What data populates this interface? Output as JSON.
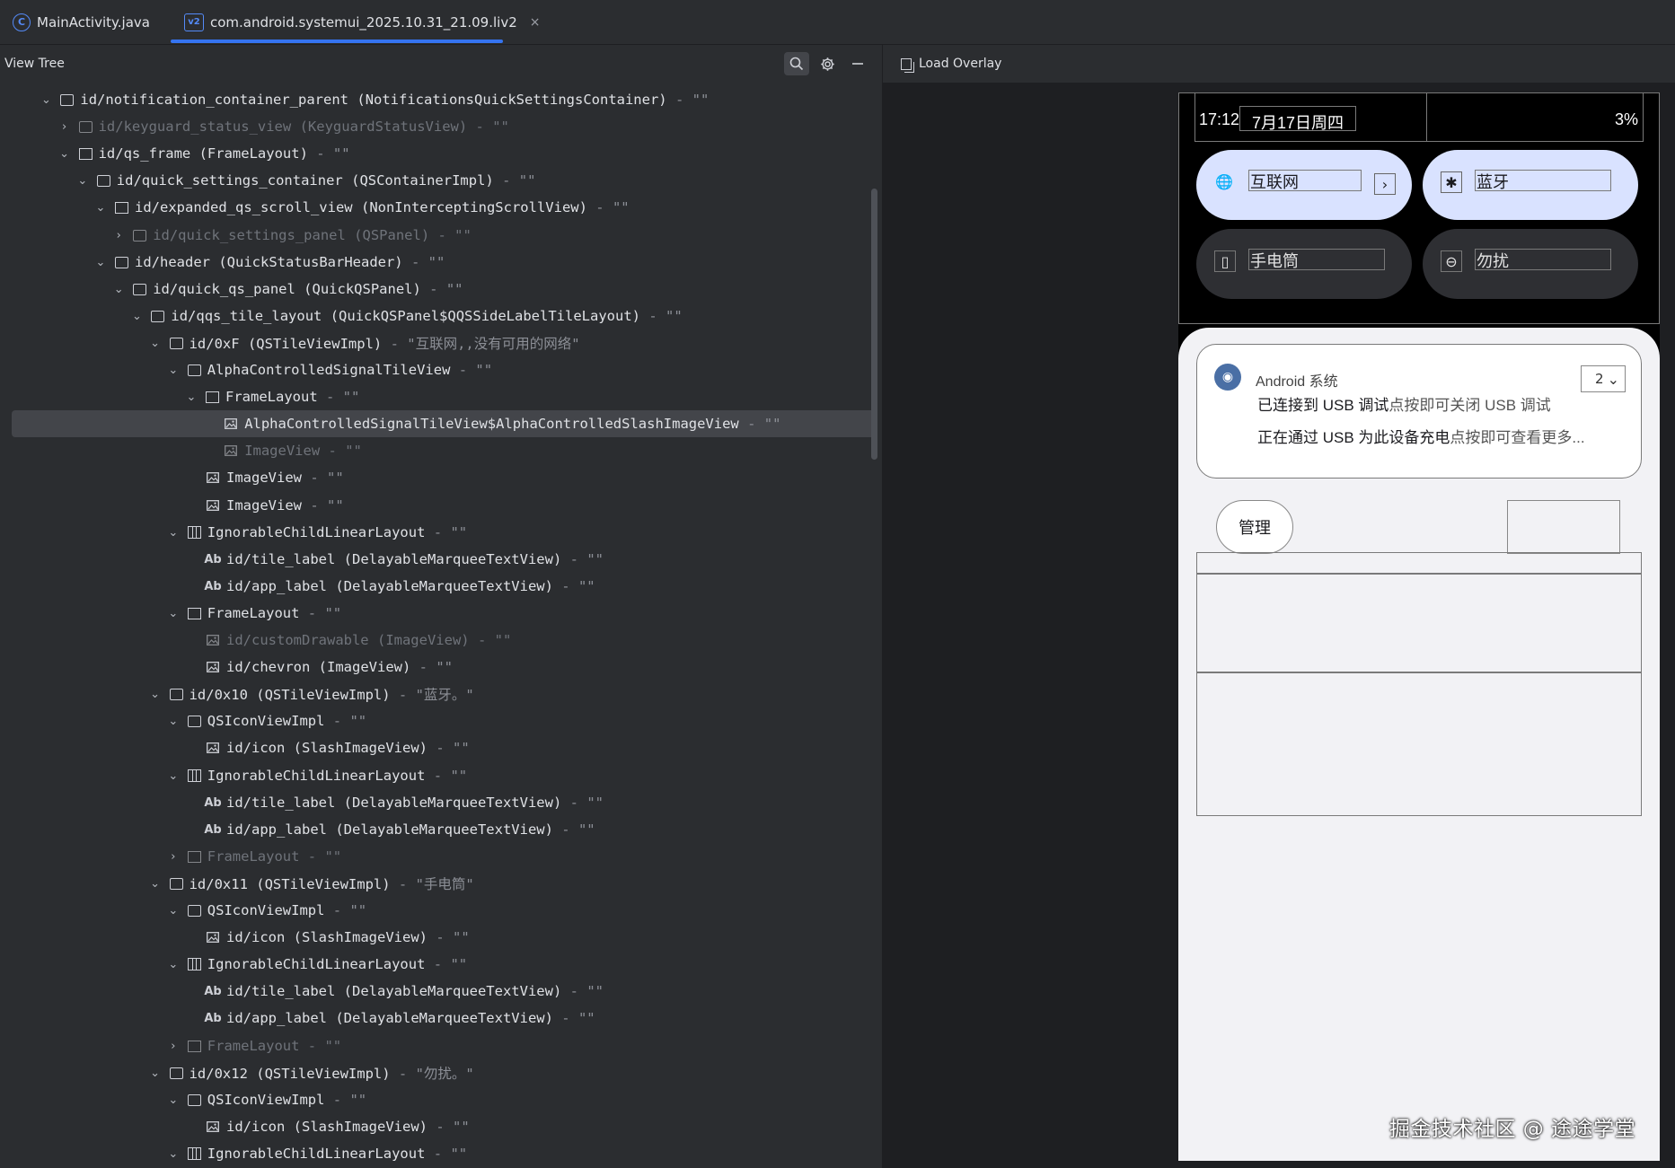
{
  "tabs": [
    {
      "icon": "class-icon",
      "icon_glyph": "C",
      "label": "MainActivity.java"
    },
    {
      "icon": "layout-file-icon",
      "icon_glyph": "v2",
      "label": "com.android.systemui_2025.10.31_21.09.liv2",
      "close_glyph": "×"
    }
  ],
  "left_panel": {
    "title": "View Tree",
    "tree": [
      {
        "chev": "⌄",
        "icon": "view",
        "id": "id/notification_container_parent",
        "cls": "(NotificationsQuickSettingsContainer)",
        "text": "\"\""
      },
      {
        "chev": "›",
        "icon": "view",
        "id": "id/keyguard_status_view",
        "cls": "(KeyguardStatusView)",
        "text": "\"\"",
        "disabled": true
      },
      {
        "chev": "⌄",
        "icon": "frame",
        "id": "id/qs_frame",
        "cls": "(FrameLayout)",
        "text": "\"\""
      },
      {
        "chev": "⌄",
        "icon": "view",
        "id": "id/quick_settings_container",
        "cls": "(QSContainerImpl)",
        "text": "\"\""
      },
      {
        "chev": "⌄",
        "icon": "frame",
        "id": "id/expanded_qs_scroll_view",
        "cls": "(NonInterceptingScrollView)",
        "text": "\"\""
      },
      {
        "chev": "›",
        "icon": "view",
        "id": "id/quick_settings_panel",
        "cls": "(QSPanel)",
        "text": "\"\"",
        "disabled": true
      },
      {
        "chev": "⌄",
        "icon": "view",
        "id": "id/header",
        "cls": "(QuickStatusBarHeader)",
        "text": "\"\""
      },
      {
        "chev": "⌄",
        "icon": "view",
        "id": "id/quick_qs_panel",
        "cls": "(QuickQSPanel)",
        "text": "\"\""
      },
      {
        "chev": "⌄",
        "icon": "view",
        "id": "id/qqs_tile_layout",
        "cls": "(QuickQSPanel$QQSSideLabelTileLayout)",
        "text": "\"\""
      },
      {
        "chev": "⌄",
        "icon": "view",
        "id": "id/0xF",
        "cls": "(QSTileViewImpl)",
        "text": "\"互联网,,没有可用的网络\""
      },
      {
        "chev": "⌄",
        "icon": "view",
        "id": "AlphaControlledSignalTileView",
        "cls": "",
        "text": "\"\""
      },
      {
        "chev": "⌄",
        "icon": "frame",
        "id": "FrameLayout",
        "cls": "",
        "text": "\"\""
      },
      {
        "chev": "",
        "icon": "image",
        "id": "AlphaControlledSignalTileView$AlphaControlledSlashImageView",
        "cls": "",
        "text": "\"\"",
        "selected": true
      },
      {
        "chev": "",
        "icon": "image",
        "id": "ImageView",
        "cls": "",
        "text": "\"\"",
        "disabled": true
      },
      {
        "chev": "",
        "icon": "image",
        "id": "ImageView",
        "cls": "",
        "text": "\"\""
      },
      {
        "chev": "",
        "icon": "image",
        "id": "ImageView",
        "cls": "",
        "text": "\"\""
      },
      {
        "chev": "⌄",
        "icon": "linear",
        "id": "IgnorableChildLinearLayout",
        "cls": "",
        "text": "\"\""
      },
      {
        "chev": "",
        "icon": "text",
        "id": "id/tile_label",
        "cls": "(DelayableMarqueeTextView)",
        "text": "\"\""
      },
      {
        "chev": "",
        "icon": "text",
        "id": "id/app_label",
        "cls": "(DelayableMarqueeTextView)",
        "text": "\"\""
      },
      {
        "chev": "⌄",
        "icon": "frame",
        "id": "FrameLayout",
        "cls": "",
        "text": "\"\""
      },
      {
        "chev": "",
        "icon": "image",
        "id": "id/customDrawable",
        "cls": "(ImageView)",
        "text": "\"\"",
        "disabled": true
      },
      {
        "chev": "",
        "icon": "image",
        "id": "id/chevron",
        "cls": "(ImageView)",
        "text": "\"\""
      },
      {
        "chev": "⌄",
        "icon": "view",
        "id": "id/0x10",
        "cls": "(QSTileViewImpl)",
        "text": "\"蓝牙。\""
      },
      {
        "chev": "⌄",
        "icon": "view",
        "id": "QSIconViewImpl",
        "cls": "",
        "text": "\"\""
      },
      {
        "chev": "",
        "icon": "image",
        "id": "id/icon",
        "cls": "(SlashImageView)",
        "text": "\"\""
      },
      {
        "chev": "⌄",
        "icon": "linear",
        "id": "IgnorableChildLinearLayout",
        "cls": "",
        "text": "\"\""
      },
      {
        "chev": "",
        "icon": "text",
        "id": "id/tile_label",
        "cls": "(DelayableMarqueeTextView)",
        "text": "\"\""
      },
      {
        "chev": "",
        "icon": "text",
        "id": "id/app_label",
        "cls": "(DelayableMarqueeTextView)",
        "text": "\"\""
      },
      {
        "chev": "›",
        "icon": "frame",
        "id": "FrameLayout",
        "cls": "",
        "text": "\"\"",
        "disabled": true
      },
      {
        "chev": "⌄",
        "icon": "view",
        "id": "id/0x11",
        "cls": "(QSTileViewImpl)",
        "text": "\"手电筒\""
      },
      {
        "chev": "⌄",
        "icon": "view",
        "id": "QSIconViewImpl",
        "cls": "",
        "text": "\"\""
      },
      {
        "chev": "",
        "icon": "image",
        "id": "id/icon",
        "cls": "(SlashImageView)",
        "text": "\"\""
      },
      {
        "chev": "⌄",
        "icon": "linear",
        "id": "IgnorableChildLinearLayout",
        "cls": "",
        "text": "\"\""
      },
      {
        "chev": "",
        "icon": "text",
        "id": "id/tile_label",
        "cls": "(DelayableMarqueeTextView)",
        "text": "\"\""
      },
      {
        "chev": "",
        "icon": "text",
        "id": "id/app_label",
        "cls": "(DelayableMarqueeTextView)",
        "text": "\"\""
      },
      {
        "chev": "›",
        "icon": "frame",
        "id": "FrameLayout",
        "cls": "",
        "text": "\"\"",
        "disabled": true
      },
      {
        "chev": "⌄",
        "icon": "view",
        "id": "id/0x12",
        "cls": "(QSTileViewImpl)",
        "text": "\"勿扰。\""
      },
      {
        "chev": "⌄",
        "icon": "view",
        "id": "QSIconViewImpl",
        "cls": "",
        "text": "\"\""
      },
      {
        "chev": "",
        "icon": "image",
        "id": "id/icon",
        "cls": "(SlashImageView)",
        "text": "\"\""
      },
      {
        "chev": "⌄",
        "icon": "linear",
        "id": "IgnorableChildLinearLayout",
        "cls": "",
        "text": "\"\""
      }
    ],
    "depths": [
      2,
      3,
      3,
      4,
      5,
      6,
      5,
      6,
      7,
      8,
      9,
      10,
      11,
      11,
      10,
      10,
      9,
      10,
      10,
      9,
      10,
      10,
      8,
      9,
      10,
      9,
      10,
      10,
      9,
      8,
      9,
      10,
      9,
      10,
      10,
      9,
      8,
      9,
      10,
      9
    ]
  },
  "right_panel": {
    "overlay_label": "Load Overlay"
  },
  "device": {
    "status_bar": {
      "time": "17:12",
      "date": "7月17日周四",
      "battery": "3%"
    },
    "tiles": [
      {
        "label": "互联网",
        "icon": "globe-icon",
        "glyph": "🌐",
        "state": "on",
        "chevron": "›"
      },
      {
        "label": "蓝牙",
        "icon": "bluetooth-icon",
        "glyph": "✱",
        "state": "on"
      },
      {
        "label": "手电筒",
        "icon": "flashlight-icon",
        "glyph": "▯",
        "state": "off"
      },
      {
        "label": "勿扰",
        "icon": "do-not-disturb-icon",
        "glyph": "⊖",
        "state": "off"
      }
    ],
    "notification": {
      "app_name": "Android 系统",
      "count": "2",
      "expand_glyph": "⌄",
      "lines": [
        {
          "title": "已连接到 USB 调试",
          "sub": "点按即可关闭 USB 调试"
        },
        {
          "title": "正在通过 USB 为此设备充电",
          "sub": "点按即可查看更多..."
        }
      ]
    },
    "manage_label": "管理",
    "colors": {
      "tile_on": "#d9e2ff",
      "tile_off": "#2e2f33",
      "shade_bg": "#f2f2f5"
    }
  },
  "watermark": "掘金技术社区 @ 途途学堂"
}
